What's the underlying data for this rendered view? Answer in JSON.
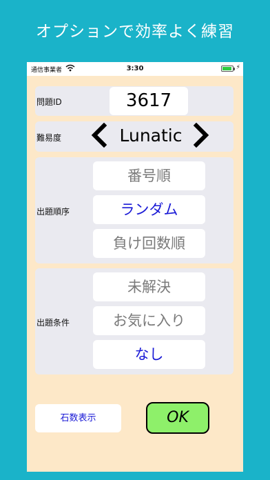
{
  "headline": "オプションで効率よく練習",
  "status_bar": {
    "carrier": "通信事業者",
    "time": "3:30",
    "battery_level": 0.85
  },
  "problem_id": {
    "label": "問題ID",
    "value": "3617"
  },
  "difficulty": {
    "label": "難易度",
    "value": "Lunatic",
    "prev_icon": "chevron-left-icon",
    "next_icon": "chevron-right-icon"
  },
  "order": {
    "label": "出題順序",
    "options": [
      "番号順",
      "ランダム",
      "負け回数順"
    ],
    "selected": "ランダム"
  },
  "condition": {
    "label": "出題条件",
    "options": [
      "未解決",
      "お気に入り",
      "なし"
    ],
    "selected": "なし"
  },
  "buttons": {
    "stone_display": "石数表示",
    "ok": "OK"
  },
  "colors": {
    "background": "#1ab3c9",
    "screen": "#fde8c8",
    "selected_text": "#1a1ad6",
    "ok_button": "#8ef06a"
  }
}
